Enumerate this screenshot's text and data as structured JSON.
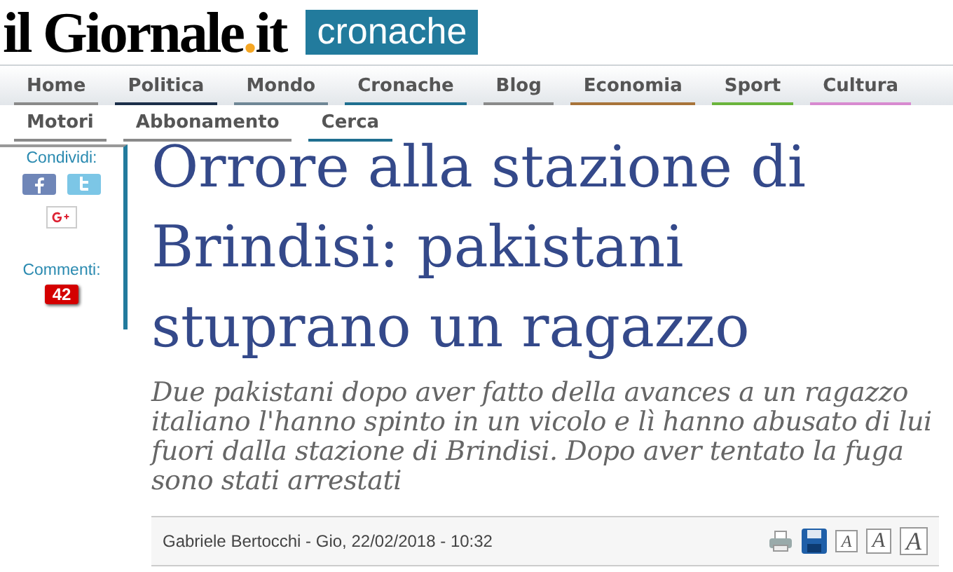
{
  "logo": {
    "name": "il Giornale",
    "dot": ".",
    "tld": "it"
  },
  "section": "cronache",
  "nav": {
    "rows": [
      {
        "items": [
          {
            "label": "Home",
            "color": "#8a8a8a"
          },
          {
            "label": "Politica",
            "color": "#1c2f4a"
          },
          {
            "label": "Mondo",
            "color": "#6f8796"
          },
          {
            "label": "Cronache",
            "color": "#1f6f90"
          },
          {
            "label": "Blog",
            "color": "#8a8a8a"
          },
          {
            "label": "Economia",
            "color": "#a8743a"
          },
          {
            "label": "Sport",
            "color": "#6ab43c"
          },
          {
            "label": "Cultura",
            "color": "#d88ad0"
          }
        ]
      },
      {
        "items": [
          {
            "label": "Motori",
            "color": "#8a8a8a"
          },
          {
            "label": "Abbonamento",
            "color": "#8a8a8a"
          },
          {
            "label": "Cerca",
            "color": "#1f6f90"
          }
        ]
      }
    ]
  },
  "sidebar": {
    "share_label": "Condividi:",
    "comments_label": "Commenti:",
    "comments_count": "42"
  },
  "article": {
    "title": "Orrore alla stazione di Brindisi: pakistani stuprano un ragazzo",
    "summary": "Due pakistani dopo aver fatto della avances a un ragazzo italiano l'hanno spinto in un vicolo e lì hanno abusato di lui fuori dalla stazione di Brindisi. Dopo aver tentato la fuga sono stati arrestati",
    "byline": "Gabriele Bertocchi - Gio, 22/02/2018 - 10:32",
    "font_buttons": [
      "A",
      "A",
      "A"
    ]
  }
}
